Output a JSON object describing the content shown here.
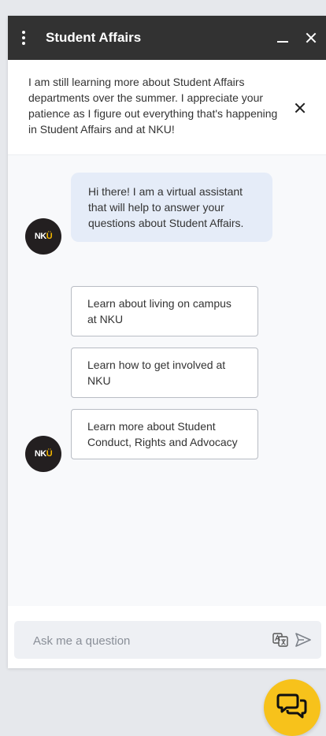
{
  "header": {
    "title": "Student Affairs",
    "menu_icon": "kebab-menu-icon",
    "minimize_icon": "minimize-icon",
    "close_icon": "close-icon"
  },
  "notice": {
    "text": "I am still learning more about Student Affairs departments over the summer. I appreciate your patience as I figure out everything that's happening in Student Affairs and at NKU!",
    "dismiss_icon": "close-icon"
  },
  "bot": {
    "avatar_text": "NKU",
    "greeting": "Hi there! I am a virtual assistant that will help to answer your questions about Student Affairs."
  },
  "options": [
    {
      "label": "Learn about living on campus at NKU"
    },
    {
      "label": "Learn how to get involved at NKU"
    },
    {
      "label": "Learn more about Student Conduct, Rights and Advocacy"
    }
  ],
  "composer": {
    "placeholder": "Ask me a question",
    "translate_icon": "translate-icon",
    "send_icon": "send-icon"
  },
  "launcher": {
    "icon": "chat-bubbles-icon"
  },
  "colors": {
    "header_bg": "#323232",
    "bubble_bg": "#e5ecf8",
    "chat_bg": "#f8f9fb",
    "launcher_bg": "#f7c21b",
    "page_bg": "#e6e8ec",
    "logo_accent": "#f2b600"
  }
}
